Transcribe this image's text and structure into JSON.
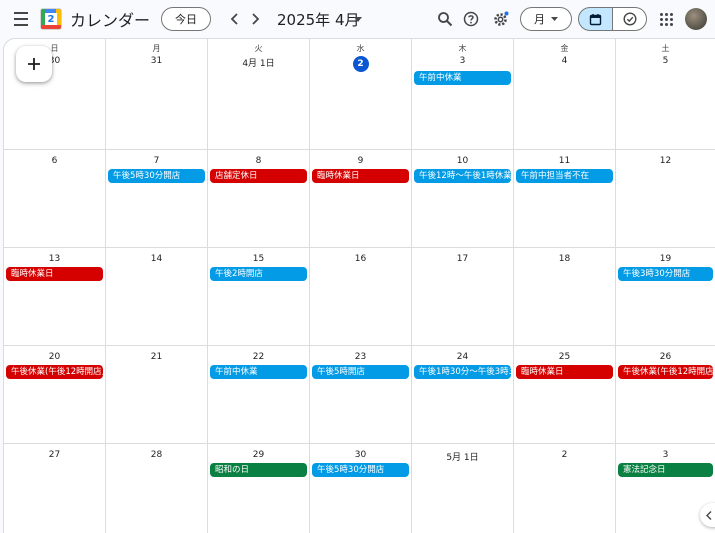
{
  "header": {
    "logo_day": "2",
    "app_title": "カレンダー",
    "today_label": "今日",
    "month_label": "2025年 4月",
    "view_label": "月"
  },
  "weekdays": [
    "日",
    "月",
    "火",
    "水",
    "木",
    "金",
    "土"
  ],
  "days": [
    "30",
    "31",
    "4月 1日",
    "2",
    "3",
    "4",
    "5",
    "6",
    "7",
    "8",
    "9",
    "10",
    "11",
    "12",
    "13",
    "14",
    "15",
    "16",
    "17",
    "18",
    "19",
    "20",
    "21",
    "22",
    "23",
    "24",
    "25",
    "26",
    "27",
    "28",
    "29",
    "30",
    "5月 1日",
    "2",
    "3"
  ],
  "today_index": 3,
  "events": [
    {
      "cell": 4,
      "title": "午前中休業",
      "color": "blue"
    },
    {
      "cell": 8,
      "title": "午後5時30分開店",
      "color": "blue"
    },
    {
      "cell": 9,
      "title": "店舗定休日",
      "color": "red"
    },
    {
      "cell": 10,
      "title": "臨時休業日",
      "color": "red"
    },
    {
      "cell": 11,
      "title": "午後12時～午後1時休業",
      "color": "blue"
    },
    {
      "cell": 12,
      "title": "午前中担当者不在",
      "color": "blue"
    },
    {
      "cell": 14,
      "title": "臨時休業日",
      "color": "red"
    },
    {
      "cell": 16,
      "title": "午後2時開店",
      "color": "blue"
    },
    {
      "cell": 20,
      "title": "午後3時30分開店",
      "color": "blue"
    },
    {
      "cell": 21,
      "title": "午後休業(午後12時開店)",
      "color": "red"
    },
    {
      "cell": 23,
      "title": "午前中休業",
      "color": "blue"
    },
    {
      "cell": 24,
      "title": "午後5時開店",
      "color": "blue"
    },
    {
      "cell": 25,
      "title": "午後1時30分～午後3時3",
      "color": "blue"
    },
    {
      "cell": 26,
      "title": "臨時休業日",
      "color": "red"
    },
    {
      "cell": 27,
      "title": "午後休業(午後12時開店)",
      "color": "red"
    },
    {
      "cell": 30,
      "title": "昭和の日",
      "color": "green"
    },
    {
      "cell": 31,
      "title": "午後5時30分開店",
      "color": "blue"
    },
    {
      "cell": 34,
      "title": "憲法記念日",
      "color": "green"
    }
  ],
  "colors": {
    "blue": "#039be5",
    "red": "#d50000",
    "green": "#0b8043",
    "today": "#0b57d0"
  }
}
